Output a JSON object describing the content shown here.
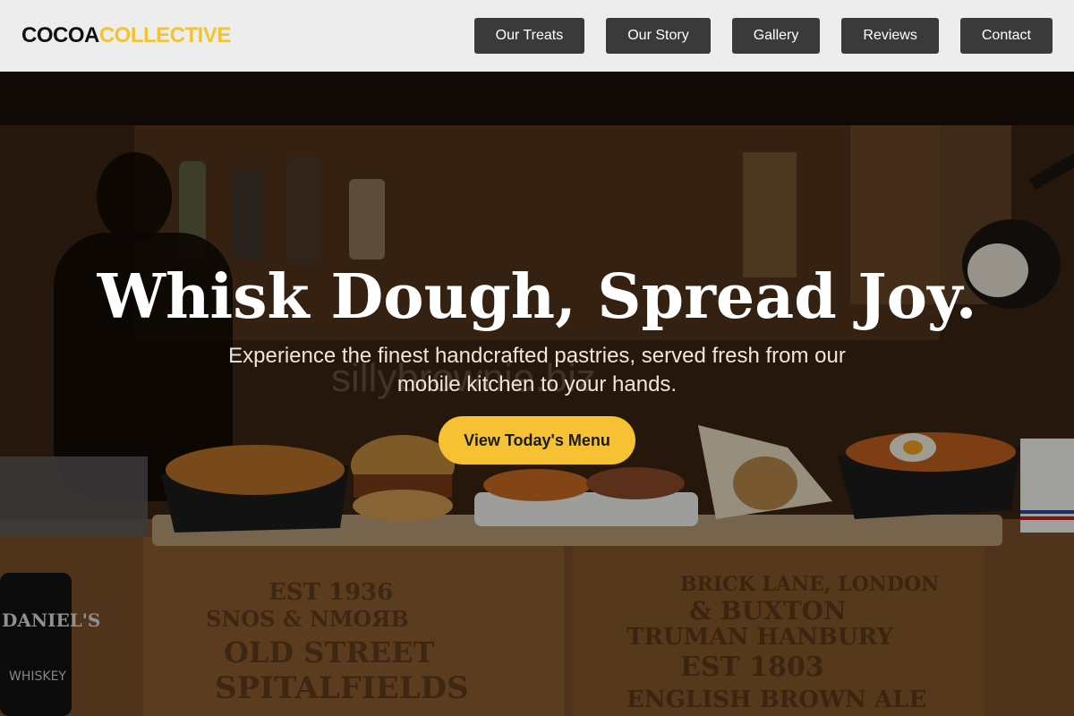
{
  "header": {
    "logo_part1": "COCOA",
    "logo_part2": "COLLECTIVE",
    "nav": [
      {
        "label": "Our Treats"
      },
      {
        "label": "Our Story"
      },
      {
        "label": "Gallery"
      },
      {
        "label": "Reviews"
      },
      {
        "label": "Contact"
      }
    ]
  },
  "hero": {
    "headline": "Whisk Dough, Spread Joy.",
    "subtitle": "Experience the finest handcrafted pastries, served fresh from our mobile kitchen to your hands.",
    "cta_label": "View Today's Menu",
    "watermark": "sillybrownie.biz"
  },
  "colors": {
    "accent": "#f6c233",
    "logo_accent": "#f4c430",
    "nav_button": "#3a3a3a",
    "header_bg": "#ededed"
  }
}
